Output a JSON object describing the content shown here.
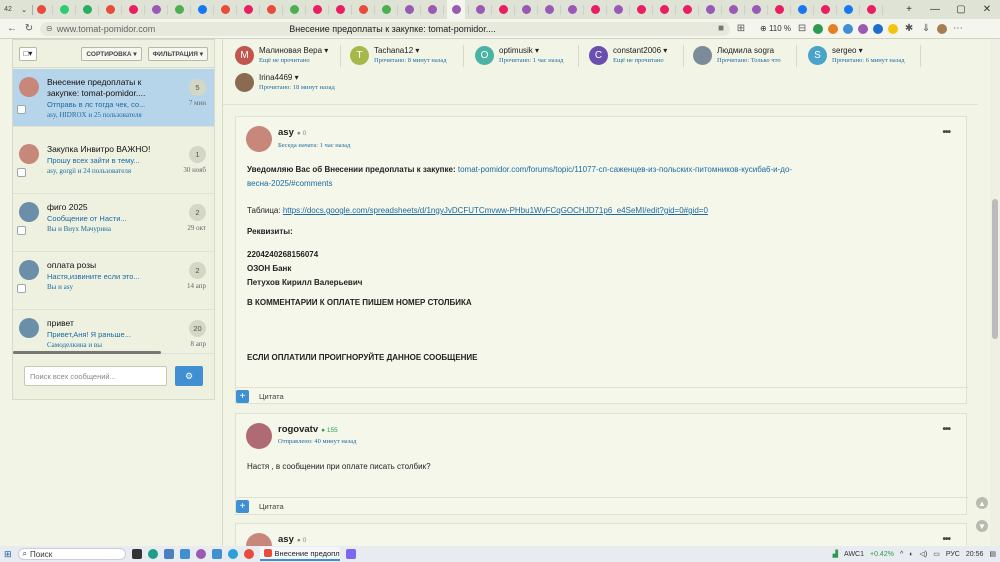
{
  "browser": {
    "tab_count_label": "42",
    "url_host": "www.tomat-pomidor.com",
    "page_title": "Внесение предоплаты к закупке: tomat-pomidor....",
    "zoom": "110 %",
    "tab_favicons": [
      "#e74c3c",
      "#2ecc71",
      "#27ae60",
      "#e74c3c",
      "#e91e63",
      "#9b59b6",
      "#4caf50",
      "#1877f2",
      "#e74c3c",
      "#e91e63",
      "#e74c3c",
      "#4caf50",
      "#e91e63",
      "#e91e63",
      "#e74c3c",
      "#4caf50",
      "#9b59b6",
      "#9b59b6",
      "#9b59b6",
      "#9b59b6",
      "#e91e63",
      "#9b59b6",
      "#9b59b6",
      "#9b59b6",
      "#e91e63",
      "#9b59b6",
      "#e91e63",
      "#e91e63",
      "#e91e63",
      "#9b59b6",
      "#9b59b6",
      "#9b59b6",
      "#e91e63",
      "#1877f2",
      "#e91e63",
      "#1877f2",
      "#e91e63"
    ]
  },
  "messenger": {
    "sort_label": "СОРТИРОВКА ▾",
    "filter_label": "ФИЛЬТРАЦИЯ ▾",
    "search_placeholder": "Поиск всех сообщений...",
    "conversations": [
      {
        "title": "Внесение предоплаты к закупке: tomat-pomidor....",
        "title2": "закупке: tomat-pomidor....",
        "title1": "Внесение предоплаты к",
        "snippet": "Отправь в лс тогда чек, со...",
        "people": "asy, HIDROX и 25 пользователя",
        "count": "5",
        "time": "7 мин",
        "avatar": "#c8877b"
      },
      {
        "title1": "Закупка Инвитро ВАЖНО!",
        "title2": "",
        "snippet": "Прошу всех зайти в тему...",
        "people": "asy, gorgii и 24 пользователя",
        "count": "1",
        "time": "30 нояб",
        "avatar": "#c8877b"
      },
      {
        "title1": "фиго 2025",
        "title2": "",
        "snippet": "Сообщение от Насти...",
        "people": "Вы и Виух Мачурина",
        "count": "2",
        "time": "29 окт",
        "avatar": "#6b8fa8"
      },
      {
        "title1": "оплата розы",
        "title2": "",
        "snippet": "Настя,извините если это...",
        "people": "Вы и asy",
        "count": "2",
        "time": "14 апр",
        "avatar": "#6b8fa8"
      },
      {
        "title1": "привет",
        "title2": "",
        "snippet": "Привет,Аня!   Я раньше...",
        "people": "Самоделкина и вы",
        "count": "20",
        "time": "8 апр",
        "avatar": "#6b8fa8"
      }
    ]
  },
  "participants": [
    {
      "name": "Малиновая Вера ▾",
      "status": "Ещё не прочитано",
      "initial": "M",
      "color": "#c0564e"
    },
    {
      "name": "Tachana12 ▾",
      "status": "Прочитано: 8 минут назад",
      "initial": "T",
      "color": "#a6b84a"
    },
    {
      "name": "optimusik ▾",
      "status": "Прочитано: 1 час назад",
      "initial": "O",
      "color": "#4ab3a6"
    },
    {
      "name": "constant2006 ▾",
      "status": "Ещё не прочитано",
      "initial": "C",
      "color": "#6a4fb0"
    },
    {
      "name": "Людмила sogra",
      "status": "Прочитано: Только что",
      "initial": "",
      "color": "#7b8b9a"
    },
    {
      "name": "sergeo ▾",
      "status": "Прочитано: 6 минут назад",
      "initial": "S",
      "color": "#4aa3c8"
    },
    {
      "name": "Irina4469 ▾",
      "status": "Прочитано: 18 минут назад",
      "initial": "",
      "color": "#8a6b52"
    }
  ],
  "posts": [
    {
      "author": "asy",
      "rep": "● 0",
      "meta": "Беседа начата: 1 час назад",
      "bold_intro": "Уведомляю Вас об Внесении предоплаты к закупке:",
      "link1a": "tomat-pomidor.com/forums/topic/11077-сп-саженцев-из-польских-питомников-кусиба6-и-до-",
      "link1b": "весна-2025/#comments",
      "table_label": "Таблица:",
      "table_link": "https://docs.google.com/spreadsheets/d/1ngyJvDCFUTCmvww-PHbu1WvFCqGOCHJD71p6_e4SeMI/edit?gid=0#gid=0",
      "requisites": "Реквизиты:",
      "account": " 2204240268156074",
      "bank": "ОЗОН Банк",
      "holder": "Петухов Кирилл Валерьевич",
      "comment_note": "В КОММЕНТАРИИ К ОПЛАТЕ ПИШЕМ НОМЕР СТОЛБИКА",
      "ignore_note": "ЕСЛИ ОПЛАТИЛИ ПРОИГНОРУЙТЕ ДАННОЕ СООБЩЕНИЕ",
      "quote": "Цитата"
    },
    {
      "author": "rogovatv",
      "rep": "● 155",
      "meta": "Отправлено: 40 минут назад",
      "text": "Настя , в сообщении при оплате писать столбик?",
      "quote": "Цитата"
    },
    {
      "author": "asy",
      "rep": "● 0"
    }
  ],
  "taskbar": {
    "search": "Поиск",
    "app_title": "Внесение предопл...",
    "ticker": "AWC1",
    "ticker_change": "+0.42%",
    "lang": "РУС",
    "time": "20:56"
  }
}
